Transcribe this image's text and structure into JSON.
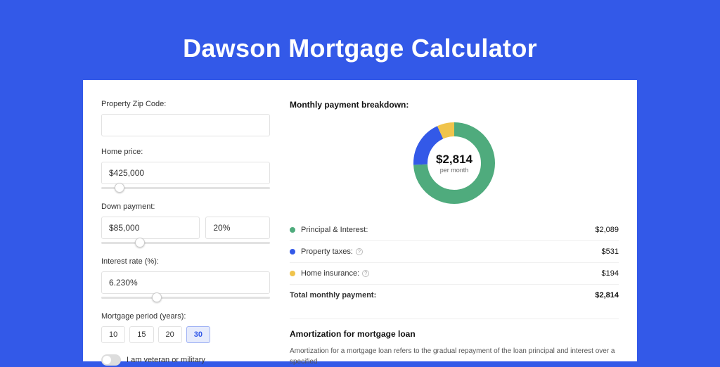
{
  "title": "Dawson Mortgage Calculator",
  "form": {
    "zip_label": "Property Zip Code:",
    "zip_value": "",
    "home_label": "Home price:",
    "home_value": "$425,000",
    "down_label": "Down payment:",
    "down_value": "$85,000",
    "down_pct": "20%",
    "rate_label": "Interest rate (%):",
    "rate_value": "6.230%",
    "period_label": "Mortgage period (years):",
    "periods": [
      "10",
      "15",
      "20",
      "30"
    ],
    "period_active": "30",
    "veteran_label": "I am veteran or military"
  },
  "breakdown": {
    "title": "Monthly payment breakdown:",
    "center_amount": "$2,814",
    "center_sub": "per month",
    "rows": [
      {
        "label": "Principal & Interest:",
        "value": "$2,089",
        "color": "#4fab7d"
      },
      {
        "label": "Property taxes:",
        "value": "$531",
        "color": "#3359e8",
        "info": true
      },
      {
        "label": "Home insurance:",
        "value": "$194",
        "color": "#f0c44c",
        "info": true
      }
    ],
    "total_label": "Total monthly payment:",
    "total_value": "$2,814"
  },
  "amort": {
    "title": "Amortization for mortgage loan",
    "text": "Amortization for a mortgage loan refers to the gradual repayment of the loan principal and interest over a specified"
  },
  "chart_data": {
    "type": "pie",
    "title": "Monthly payment breakdown",
    "categories": [
      "Principal & Interest",
      "Property taxes",
      "Home insurance"
    ],
    "values": [
      2089,
      531,
      194
    ],
    "colors": [
      "#4fab7d",
      "#3359e8",
      "#f0c44c"
    ],
    "total": 2814,
    "center_label": "$2,814 per month"
  }
}
